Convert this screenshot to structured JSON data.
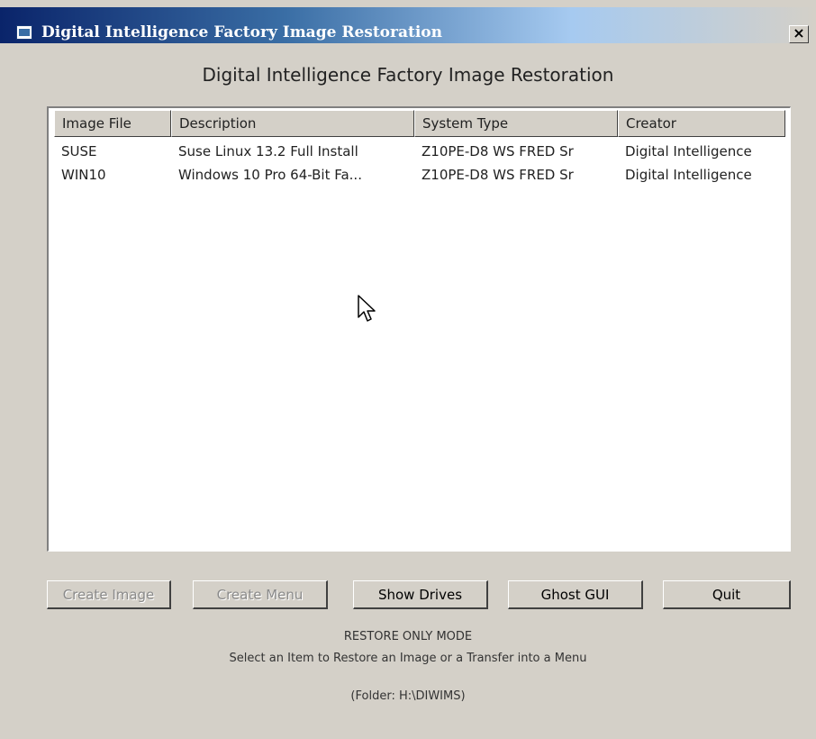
{
  "window": {
    "title": "Digital Intelligence Factory Image Restoration",
    "close_label": "×"
  },
  "heading": "Digital Intelligence Factory Image Restoration",
  "list": {
    "columns": [
      "Image File",
      "Description",
      "System Type",
      "Creator"
    ],
    "rows": [
      [
        "SUSE",
        "Suse Linux 13.2 Full Install",
        "Z10PE-D8 WS FRED Sr",
        "Digital Intelligence"
      ],
      [
        "WIN10",
        "Windows 10 Pro 64-Bit Fa...",
        "Z10PE-D8 WS FRED Sr",
        "Digital Intelligence"
      ]
    ]
  },
  "buttons": {
    "create_image": "Create Image",
    "create_menu": "Create Menu",
    "show_drives": "Show Drives",
    "ghost_gui": "Ghost GUI",
    "quit": "Quit"
  },
  "status": {
    "mode": "RESTORE ONLY MODE",
    "instruction": "Select an Item to Restore an Image or a Transfer into a Menu",
    "folder": "(Folder: H:\\DIWIMS)"
  },
  "icons": {
    "app": "app-window-icon",
    "close": "close-icon",
    "cursor": "mouse-pointer-icon"
  }
}
